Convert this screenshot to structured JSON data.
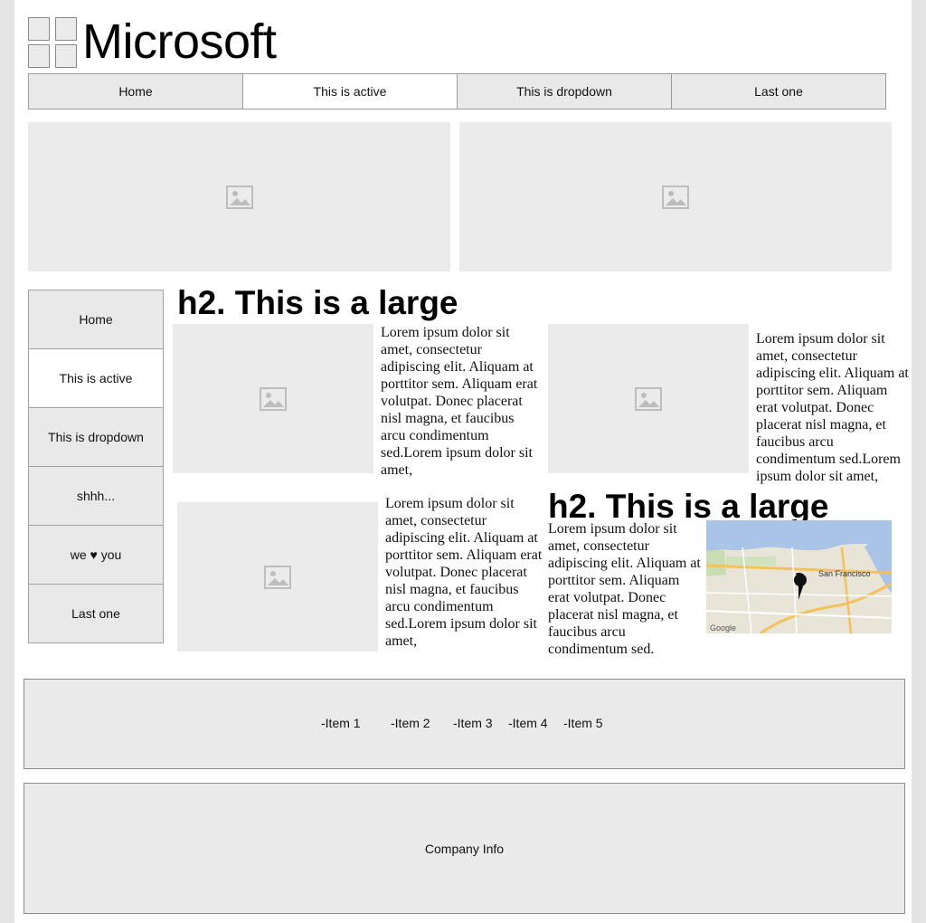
{
  "logo": {
    "text": "Microsoft"
  },
  "topnav": {
    "tabs": [
      {
        "label": "Home"
      },
      {
        "label": "This is active"
      },
      {
        "label": "This is dropdown"
      },
      {
        "label": "Last one"
      }
    ]
  },
  "sidenav": {
    "items": [
      {
        "label": "Home"
      },
      {
        "label": "This is active"
      },
      {
        "label": "This is dropdown"
      },
      {
        "label": "shhh..."
      },
      {
        "label": "we ♥ you"
      },
      {
        "label": "Last one"
      }
    ]
  },
  "content": {
    "heading1": "h2. This is a large",
    "heading2": "h2. This is a large",
    "lorem_full": "Lorem ipsum dolor sit amet, consectetur adipiscing elit. Aliquam at porttitor sem. Aliquam erat volutpat. Donec placerat nisl magna, et faucibus arcu condimentum sed.Lorem ipsum dolor sit amet,",
    "lorem_short": "Lorem ipsum dolor sit amet, consectetur adipiscing elit. Aliquam at porttitor sem. Aliquam erat volutpat. Donec placerat nisl magna, et faucibus arcu condimentum sed."
  },
  "map": {
    "city_label": "San Francisco",
    "attribution": "Google"
  },
  "footer": {
    "items": [
      {
        "label": "-Item 1"
      },
      {
        "label": "-Item 2"
      },
      {
        "label": "-Item 3"
      },
      {
        "label": "-Item 4"
      },
      {
        "label": "-Item 5"
      }
    ],
    "company_info": "Company Info"
  },
  "colors": {
    "page_bg": "#e4e4e4",
    "panel_bg": "#e9e9e9",
    "border": "#9a9a9a",
    "active_bg": "#ffffff"
  }
}
